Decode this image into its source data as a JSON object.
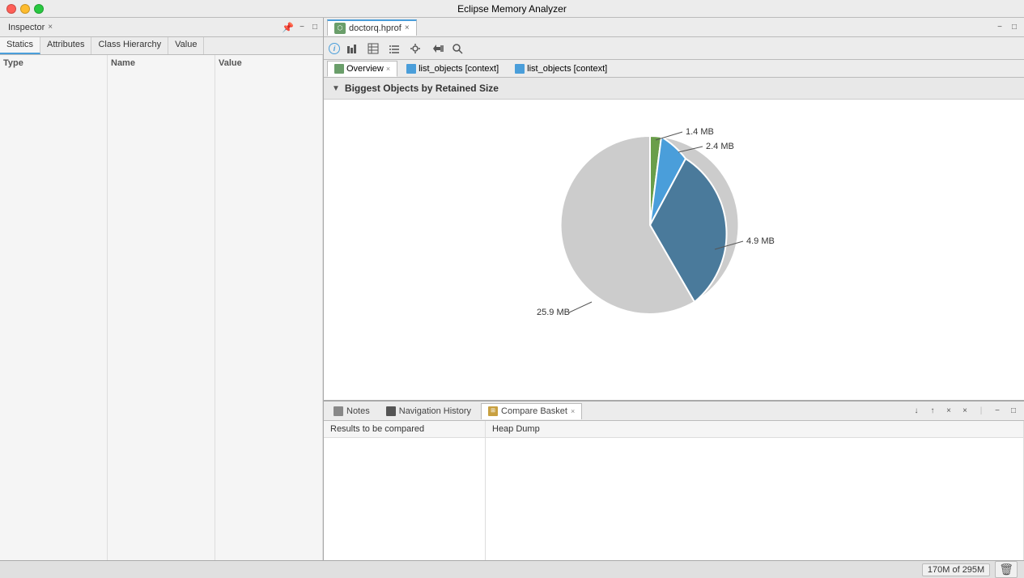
{
  "app": {
    "title": "Eclipse Memory Analyzer"
  },
  "window_controls": {
    "close_label": "×",
    "min_label": "−",
    "max_label": "□"
  },
  "left_panel": {
    "tab_label": "Inspector",
    "tab_close": "×",
    "inspector_tabs": [
      "Statics",
      "Attributes",
      "Class Hierarchy",
      "Value"
    ],
    "columns": {
      "type_header": "Type",
      "name_header": "Name",
      "value_header": "Value"
    }
  },
  "right_panel": {
    "file_tab": {
      "label": "doctorq.hprof",
      "close": "×"
    },
    "tab_bar_min": "−",
    "tab_bar_max": "□",
    "toolbar": {
      "info_tooltip": "i",
      "buttons": [
        "bar-chart",
        "table",
        "list",
        "settings",
        "nav-left",
        "search"
      ]
    },
    "inner_tabs": [
      {
        "label": "Overview",
        "close": "×",
        "active": true
      },
      {
        "label": "list_objects [context]",
        "close": null,
        "active": false
      },
      {
        "label": "list_objects [context]",
        "close": null,
        "active": false
      }
    ],
    "section": {
      "title": "Biggest Objects by Retained Size",
      "collapsed": false
    },
    "pie_chart": {
      "slices": [
        {
          "label": "25.9 MB",
          "value": 25.9,
          "color": "#cccccc",
          "angle_start": 0,
          "angle_end": 270
        },
        {
          "label": "4.9 MB",
          "value": 4.9,
          "color": "#4a7a9b",
          "angle_start": 270,
          "angle_end": 330
        },
        {
          "label": "2.4 MB",
          "value": 2.4,
          "color": "#4a9eda",
          "angle_start": 330,
          "angle_end": 355
        },
        {
          "label": "1.4 MB",
          "value": 1.4,
          "color": "#6a9e6a",
          "angle_start": 355,
          "angle_end": 360
        }
      ]
    }
  },
  "bottom_panel": {
    "tabs": [
      {
        "label": "Notes",
        "type": "notes",
        "active": false
      },
      {
        "label": "Navigation History",
        "type": "nav",
        "active": false
      },
      {
        "label": "Compare Basket",
        "type": "compare",
        "close": "×",
        "active": true
      }
    ],
    "actions": {
      "down_arrow": "↓",
      "up_arrow": "↑",
      "close1": "×",
      "close2": "×",
      "divider": "|",
      "min": "−",
      "max": "□"
    },
    "table": {
      "col1_header": "Results to be compared",
      "col2_header": "Heap Dump"
    }
  },
  "status_bar": {
    "memory_used": "170M",
    "memory_total": "295M",
    "memory_label": "170M of 295M"
  }
}
